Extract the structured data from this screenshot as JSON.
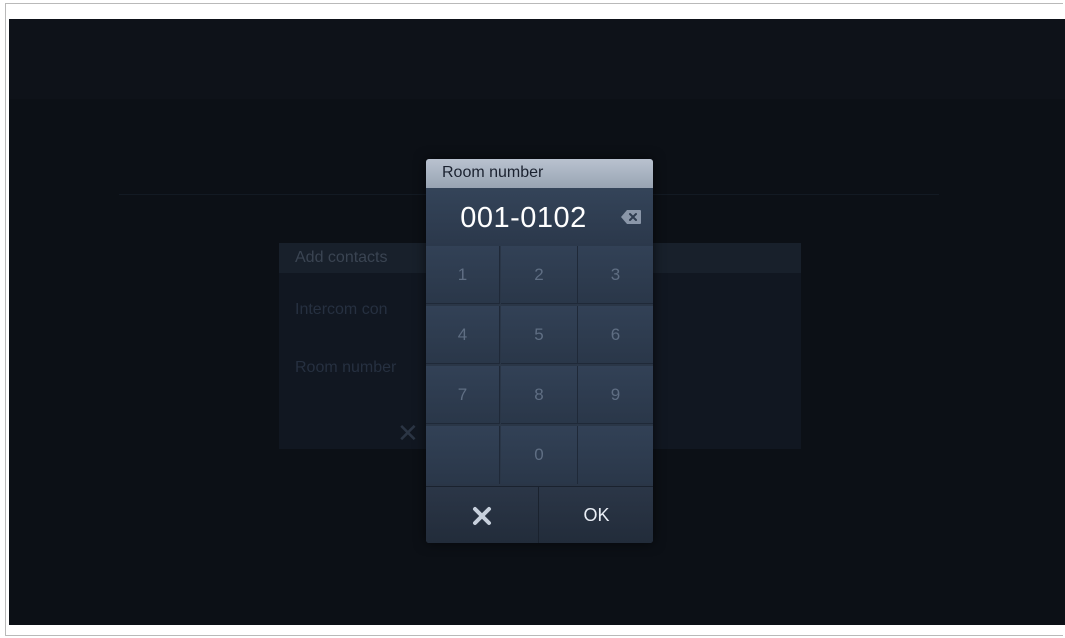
{
  "background": {
    "dialog_title": "Add contacts",
    "row1_label": "Intercom con",
    "row2_label": "Room number"
  },
  "keypad": {
    "title": "Room number",
    "value": "001-0102",
    "keys": [
      "1",
      "2",
      "3",
      "4",
      "5",
      "6",
      "7",
      "8",
      "9",
      "",
      "0",
      ""
    ],
    "ok_label": "OK"
  },
  "icons": {
    "backspace": "backspace-icon",
    "cancel": "close-icon"
  },
  "colors": {
    "screen_bg": "#0c1016",
    "keypad_bg": "#2a3647",
    "title_bar": "#b9c2cf",
    "key_text": "#5f6e83",
    "display_text": "#ffffff"
  }
}
